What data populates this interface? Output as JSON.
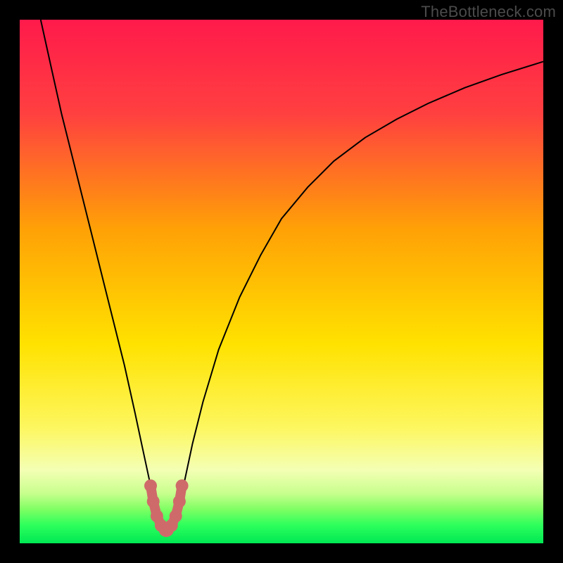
{
  "watermark": "TheBottleneck.com",
  "chart_data": {
    "type": "line",
    "title": "",
    "xlabel": "",
    "ylabel": "",
    "xlim": [
      0,
      100
    ],
    "ylim": [
      0,
      100
    ],
    "grid": false,
    "legend": false,
    "gradient_stops": [
      {
        "offset": 0.0,
        "color": "#ff1a4b"
      },
      {
        "offset": 0.18,
        "color": "#ff4040"
      },
      {
        "offset": 0.4,
        "color": "#ffa106"
      },
      {
        "offset": 0.62,
        "color": "#ffe200"
      },
      {
        "offset": 0.78,
        "color": "#fdf760"
      },
      {
        "offset": 0.86,
        "color": "#f4ffb4"
      },
      {
        "offset": 0.905,
        "color": "#c7ff8d"
      },
      {
        "offset": 0.935,
        "color": "#7fff63"
      },
      {
        "offset": 0.965,
        "color": "#2dff5c"
      },
      {
        "offset": 1.0,
        "color": "#00e853"
      }
    ],
    "series": [
      {
        "name": "bottleneck-curve",
        "x": [
          4,
          6,
          8,
          10,
          12,
          14,
          16,
          18,
          20,
          22,
          23.5,
          25,
          26,
          27,
          28,
          29,
          30,
          31.5,
          33,
          35,
          38,
          42,
          46,
          50,
          55,
          60,
          66,
          72,
          78,
          85,
          92,
          100
        ],
        "y": [
          100,
          91,
          82,
          74,
          66,
          58,
          50,
          42,
          34,
          25,
          18,
          11,
          7,
          4,
          2.5,
          4,
          7,
          12,
          19,
          27,
          37,
          47,
          55,
          62,
          68,
          73,
          77.5,
          81,
          84,
          87,
          89.5,
          92
        ]
      }
    ],
    "highlight": {
      "name": "min-region",
      "color": "#cf6a6a",
      "x": [
        25.0,
        25.5,
        26.2,
        27.0,
        27.8,
        28.0,
        28.2,
        29.0,
        29.8,
        30.5,
        31.0
      ],
      "y": [
        11.0,
        8.0,
        5.2,
        3.4,
        2.5,
        2.4,
        2.5,
        3.4,
        5.2,
        8.0,
        11.0
      ]
    }
  }
}
